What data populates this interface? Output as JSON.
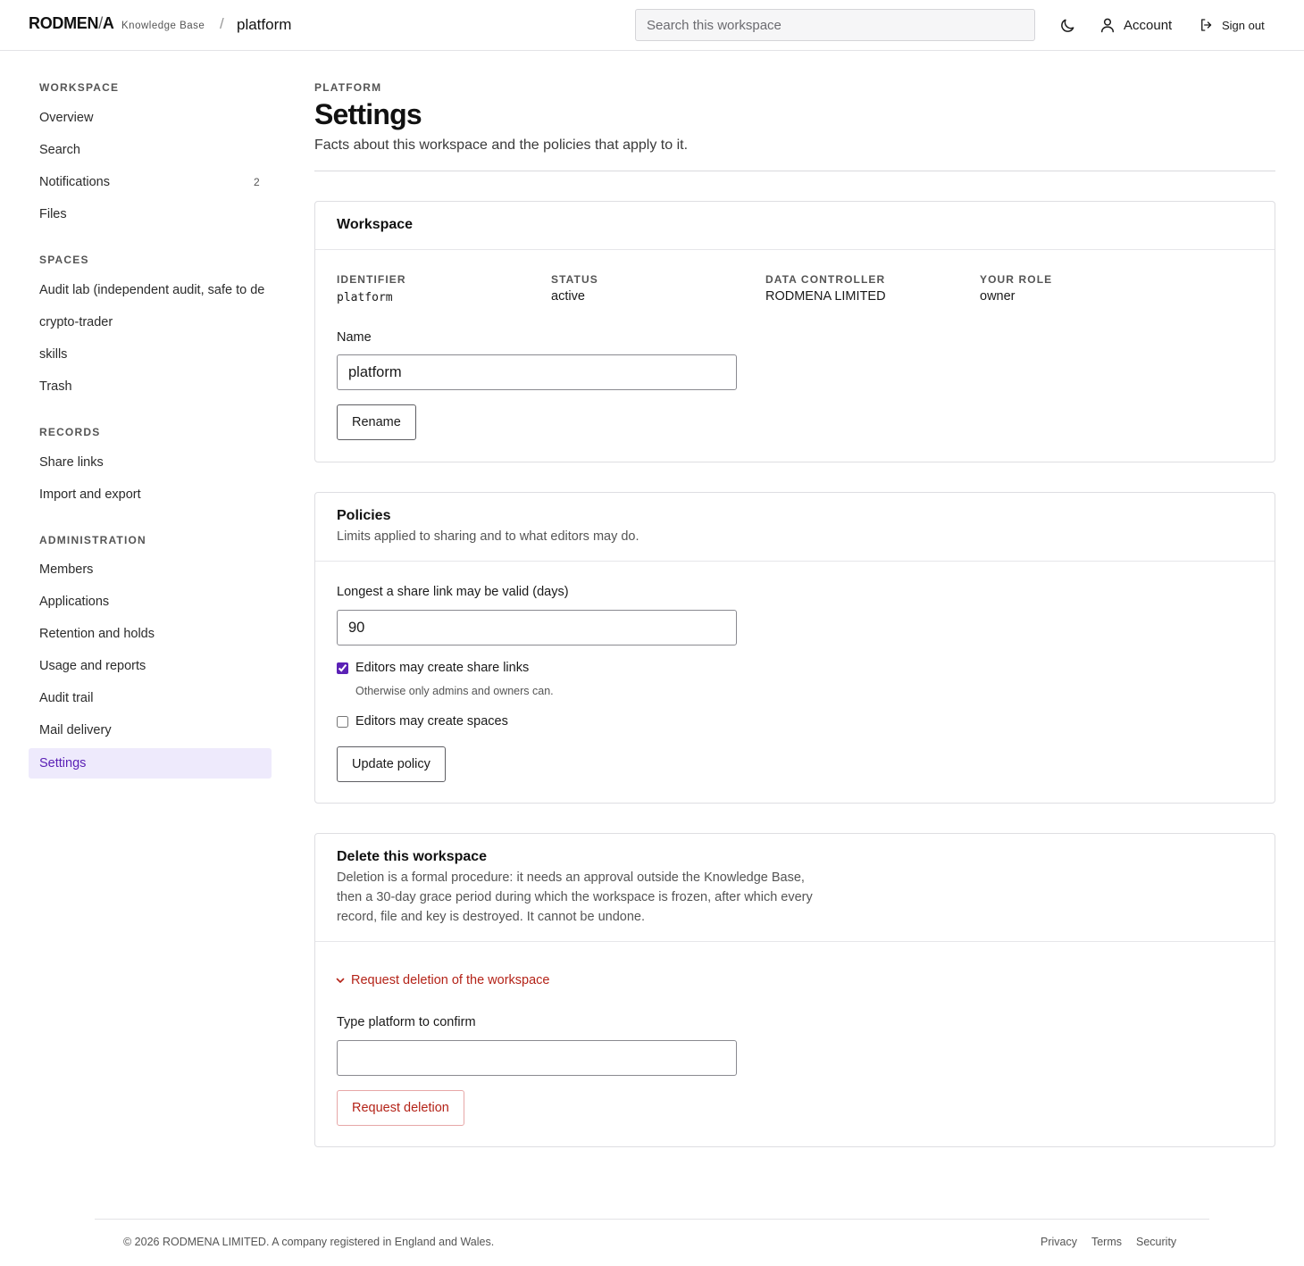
{
  "header": {
    "logo": "RODMEN",
    "logo_slash": "/",
    "logo_tail": "A",
    "product": "Knowledge Base",
    "separator": "/",
    "workspace": "platform",
    "search_placeholder": "Search this workspace",
    "theme_icon": "moon-icon",
    "account_label": "Account",
    "signout_label": "Sign out"
  },
  "sidebar": {
    "sections": [
      {
        "title": "WORKSPACE",
        "items": [
          {
            "label": "Overview"
          },
          {
            "label": "Search"
          },
          {
            "label": "Notifications",
            "badge": "2"
          },
          {
            "label": "Files"
          }
        ]
      },
      {
        "title": "SPACES",
        "items": [
          {
            "label": "Audit lab (independent audit, safe to de"
          },
          {
            "label": "crypto-trader"
          },
          {
            "label": "skills"
          },
          {
            "label": "Trash"
          }
        ]
      },
      {
        "title": "RECORDS",
        "items": [
          {
            "label": "Share links"
          },
          {
            "label": "Import and export"
          }
        ]
      },
      {
        "title": "ADMINISTRATION",
        "items": [
          {
            "label": "Members"
          },
          {
            "label": "Applications"
          },
          {
            "label": "Retention and holds"
          },
          {
            "label": "Usage and reports"
          },
          {
            "label": "Audit trail"
          },
          {
            "label": "Mail delivery"
          },
          {
            "label": "Settings",
            "active": true
          }
        ]
      }
    ]
  },
  "page": {
    "eyebrow": "PLATFORM",
    "title": "Settings",
    "subtitle": "Facts about this workspace and the policies that apply to it."
  },
  "workspace_card": {
    "title": "Workspace",
    "facts": [
      {
        "label": "IDENTIFIER",
        "value": "platform"
      },
      {
        "label": "STATUS",
        "value": "active"
      },
      {
        "label": "DATA CONTROLLER",
        "value": "RODMENA LIMITED"
      },
      {
        "label": "YOUR ROLE",
        "value": "owner"
      }
    ],
    "name_label": "Name",
    "name_value": "platform",
    "rename_label": "Rename"
  },
  "policies_card": {
    "title": "Policies",
    "description": "Limits applied to sharing and to what editors may do.",
    "max_days_label": "Longest a share link may be valid (days)",
    "max_days_value": "90",
    "editors_share_label": "Editors may create share links",
    "editors_share_checked": true,
    "editors_share_hint": "Otherwise only admins and owners can.",
    "editors_spaces_label": "Editors may create spaces",
    "editors_spaces_checked": false,
    "update_label": "Update policy"
  },
  "delete_card": {
    "title": "Delete this workspace",
    "desc_line1": "Deletion is a formal procedure: it needs an approval outside the Knowledge Base,",
    "desc_line2": "then a 30-day grace period during which the workspace is frozen, after which every",
    "desc_line3": "record, file and key is destroyed. It cannot be undone.",
    "disclosure_label": "Request deletion of the workspace",
    "confirm_label": "Type platform to confirm",
    "confirm_value": "",
    "request_label": "Request deletion",
    "danger_color": "#b42318"
  },
  "footer": {
    "copyright": "© 2026 RODMENA LIMITED. A company registered in England and Wales.",
    "links": [
      "Privacy",
      "Terms",
      "Security"
    ]
  },
  "colors": {
    "accent": "#5b21b6",
    "active_bg": "#eeeafc",
    "danger": "#b42318"
  }
}
